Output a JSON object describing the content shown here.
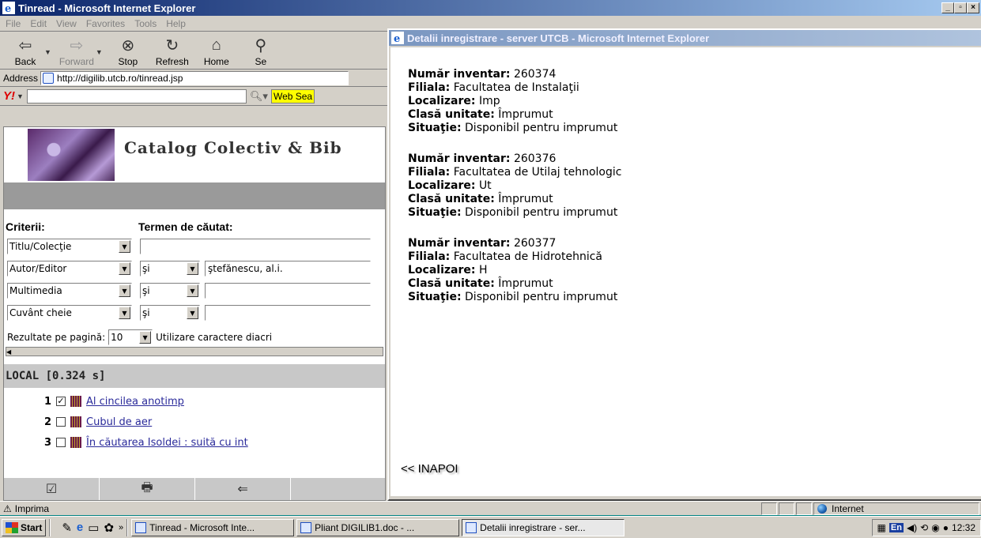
{
  "main_window": {
    "title": "Tinread - Microsoft Internet Explorer",
    "menu": [
      "File",
      "Edit",
      "View",
      "Favorites",
      "Tools",
      "Help"
    ],
    "toolbar": [
      {
        "label": "Back",
        "icon": "back-arrow-icon"
      },
      {
        "label": "Forward",
        "icon": "forward-arrow-icon"
      },
      {
        "label": "Stop",
        "icon": "stop-icon"
      },
      {
        "label": "Refresh",
        "icon": "refresh-icon"
      },
      {
        "label": "Home",
        "icon": "home-icon"
      },
      {
        "label": "Se",
        "icon": "search-icon"
      }
    ],
    "address_label": "Address",
    "address_value": "http://digilib.utcb.ro/tinread.jsp",
    "web_search_label": "Web Sea"
  },
  "page": {
    "banner_title": "Catalog Colectiv & Bib",
    "criteria_label": "Criterii:",
    "search_term_label": "Termen de căutat:",
    "rows": [
      {
        "field": "Titlu/Colecţie",
        "op": "",
        "value": ""
      },
      {
        "field": "Autor/Editor",
        "op": "şi",
        "value": "ştefănescu, al.i."
      },
      {
        "field": "Multimedia",
        "op": "şi",
        "value": ""
      },
      {
        "field": "Cuvânt cheie",
        "op": "şi",
        "value": ""
      }
    ],
    "results_per_page_label": "Rezultate pe pagină:",
    "results_per_page_value": "10",
    "diacritics_label": "Utilizare caractere diacri",
    "local_header": "LOCAL [0.324 s]",
    "results": [
      {
        "num": "1",
        "checked": true,
        "title": "Al cincilea anotimp"
      },
      {
        "num": "2",
        "checked": false,
        "title": "Cubul de aer"
      },
      {
        "num": "3",
        "checked": false,
        "title": "În căutarea Isoldei : suită cu int"
      }
    ]
  },
  "status": {
    "text": "Imprima",
    "zone": "Internet"
  },
  "popup": {
    "title": "Detalii inregistrare - server UTCB - Microsoft Internet Explorer",
    "labels": {
      "inventory": "Număr inventar:",
      "branch": "Filiala:",
      "location": "Localizare:",
      "unit_class": "Clasă unitate:",
      "status": "Situaţie:"
    },
    "records": [
      {
        "inventory": "260374",
        "branch": "Facultatea de Instalaţii",
        "location": "Imp",
        "unit_class": "Împrumut",
        "status": "Disponibil pentru imprumut"
      },
      {
        "inventory": "260376",
        "branch": "Facultatea de Utilaj tehnologic",
        "location": "Ut",
        "unit_class": "Împrumut",
        "status": "Disponibil pentru imprumut"
      },
      {
        "inventory": "260377",
        "branch": "Facultatea de Hidrotehnică",
        "location": "H",
        "unit_class": "Împrumut",
        "status": "Disponibil pentru imprumut"
      }
    ],
    "back_link": "<< INAPOI"
  },
  "taskbar": {
    "start": "Start",
    "tasks": [
      "Tinread - Microsoft Inte...",
      "Pliant DIGILIB1.doc - ...",
      "Detalii inregistrare - ser..."
    ],
    "lang": "En",
    "clock": "12:32"
  }
}
